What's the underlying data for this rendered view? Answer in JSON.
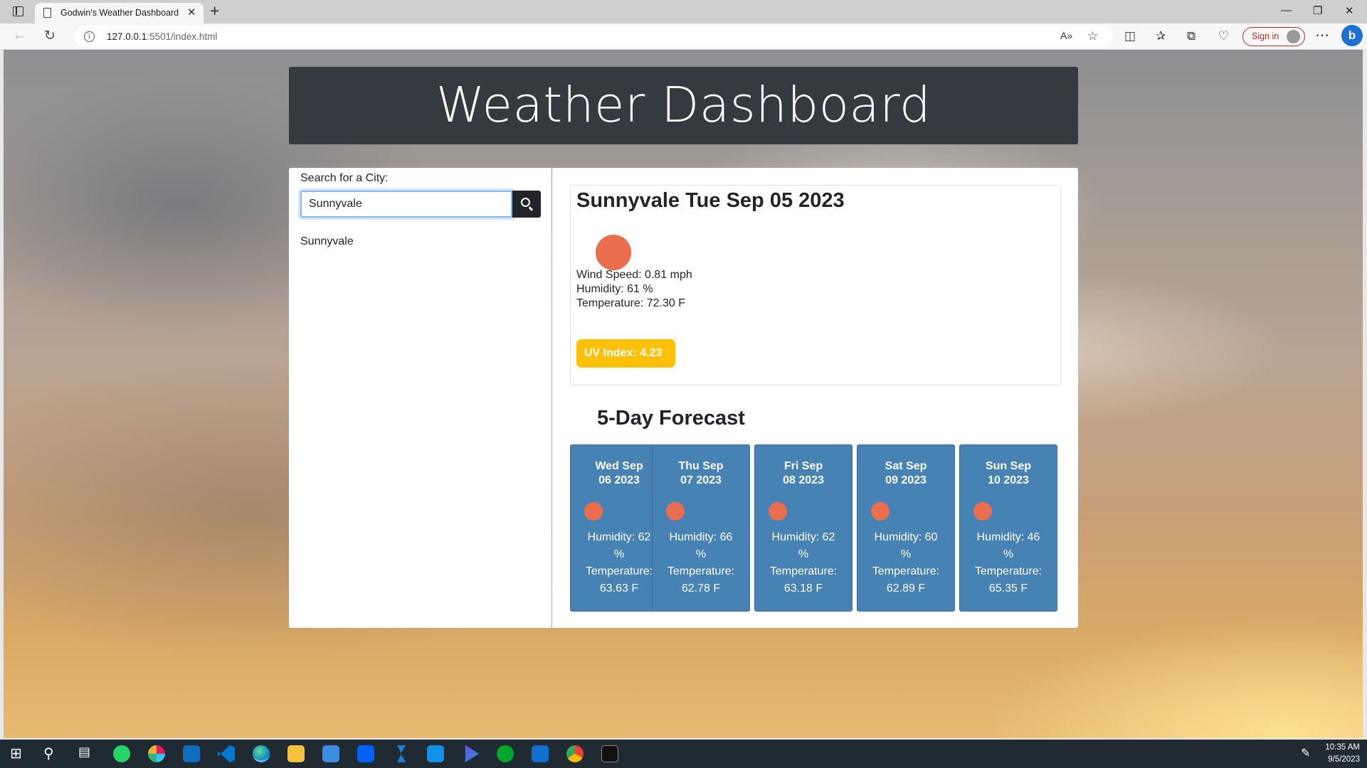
{
  "browser": {
    "tab_title": "Godwin's Weather Dashboard",
    "url_host": "127.0.0.1",
    "url_rest": ":5501/index.html",
    "sign_in_label": "Sign in"
  },
  "header": {
    "title": "Weather Dashboard"
  },
  "search": {
    "label": "Search for a City:",
    "value": "Sunnyvale",
    "history": [
      "Sunnyvale"
    ]
  },
  "current": {
    "heading": "Sunnyvale Tue Sep 05 2023",
    "wind": "Wind Speed: 0.81 mph",
    "humidity": "Humidity: 61 %",
    "temperature": "Temperature: 72.30 F",
    "uv": "UV Index: 4.23",
    "uv_color": "#ffc107"
  },
  "forecast": {
    "title": "5-Day Forecast",
    "days": [
      {
        "date_line1": "Wed Sep",
        "date_line2": "06 2023",
        "humidity_line1": "Humidity: 62",
        "humidity_line2": "%",
        "temp_line1": "Temperature:",
        "temp_line2": "63.63 F"
      },
      {
        "date_line1": "Thu Sep",
        "date_line2": "07 2023",
        "humidity_line1": "Humidity: 66",
        "humidity_line2": "%",
        "temp_line1": "Temperature:",
        "temp_line2": "62.78 F"
      },
      {
        "date_line1": "Fri Sep",
        "date_line2": "08 2023",
        "humidity_line1": "Humidity: 62",
        "humidity_line2": "%",
        "temp_line1": "Temperature:",
        "temp_line2": "63.18 F"
      },
      {
        "date_line1": "Sat Sep",
        "date_line2": "09 2023",
        "humidity_line1": "Humidity: 60",
        "humidity_line2": "%",
        "temp_line1": "Temperature:",
        "temp_line2": "62.89 F"
      },
      {
        "date_line1": "Sun Sep",
        "date_line2": "10 2023",
        "humidity_line1": "Humidity: 46",
        "humidity_line2": "%",
        "temp_line1": "Temperature:",
        "temp_line2": "65.35 F"
      }
    ]
  },
  "colors": {
    "card_bg": "#4682b4",
    "weather_icon": "#ea6e4e",
    "header_bg": "#343a40"
  },
  "taskbar": {
    "time": "10:35 AM",
    "date": "9/5/2023",
    "apps": [
      "windows-start-icon",
      "search-icon",
      "task-view-icon",
      "whatsapp-icon",
      "slack-icon",
      "app-icon",
      "vscode-icon",
      "edge-icon",
      "file-explorer-icon",
      "store-icon",
      "dropbox-icon",
      "powerautomate-icon",
      "mail-icon",
      "clipchamp-icon",
      "evernote-icon",
      "webex-icon",
      "chrome-icon",
      "terminal-icon"
    ]
  }
}
